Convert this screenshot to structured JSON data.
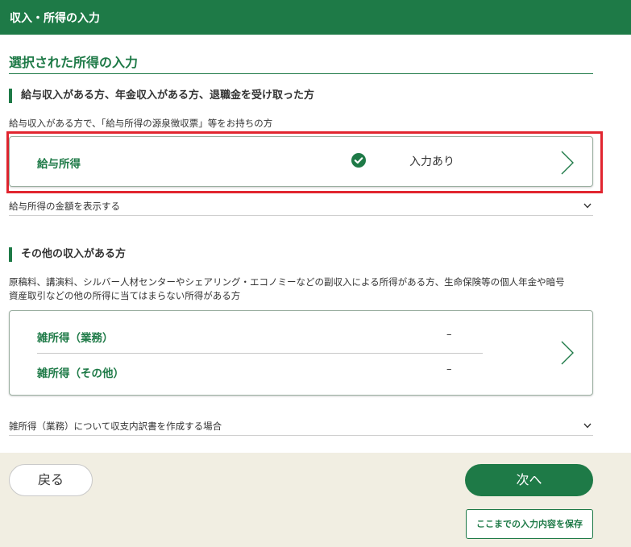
{
  "header": {
    "title": "収入・所得の入力"
  },
  "section": {
    "title": "選択された所得の入力"
  },
  "salary_group": {
    "heading": "給与収入がある方、年金収入がある方、退職金を受け取った方",
    "description": "給与収入がある方で、「給与所得の源泉徴収票」等をお持ちの方",
    "card": {
      "label": "給与所得",
      "status": "入力あり",
      "status_icon": "check-circle-icon"
    },
    "disclosure": "給与所得の金額を表示する"
  },
  "other_group": {
    "heading": "その他の収入がある方",
    "description_line1": "原稿料、講演料、シルバー人材センターやシェアリング・エコノミーなどの副収入による所得がある方、生命保険等の個人年金や暗号",
    "description_line2": "資産取引などの他の所得に当てはまらない所得がある方",
    "card": {
      "items": [
        {
          "label": "雑所得（業務）",
          "value": "–"
        },
        {
          "label": "雑所得（その他）",
          "value": "–"
        }
      ]
    },
    "disclosure": "雑所得（業務）について収支内訳書を作成する場合"
  },
  "footer": {
    "back_label": "戻る",
    "next_label": "次へ",
    "save_label": "ここまでの入力内容を保存"
  },
  "colors": {
    "brand_green": "#1e7a47",
    "highlight_red": "#e1252f",
    "footer_bg": "#f1eee2"
  }
}
